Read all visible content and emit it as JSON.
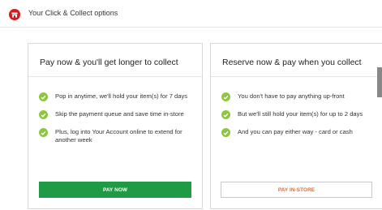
{
  "header": {
    "title": "Your Click & Collect options",
    "icon": "store-icon",
    "accent_color": "#d71920"
  },
  "cards": [
    {
      "title": "Pay now & you'll get longer to collect",
      "benefits": [
        "Pop in anytime, we'll hold your item(s) for 7 days",
        "Skip the payment queue and save time in-store",
        "Plus, log into Your Account online to extend for another week"
      ],
      "button_label": "PAY NOW",
      "button_color": "#1f9a45"
    },
    {
      "title": "Reserve now & pay when you collect",
      "benefits": [
        "You don't have to pay anything up-front",
        "But we'll still hold your item(s) for up to 2 days",
        "And you can pay either way - card or cash"
      ],
      "button_label": "PAY IN-STORE",
      "button_color": "#e06b3a"
    }
  ],
  "check_icon_color": "#8dc63f"
}
